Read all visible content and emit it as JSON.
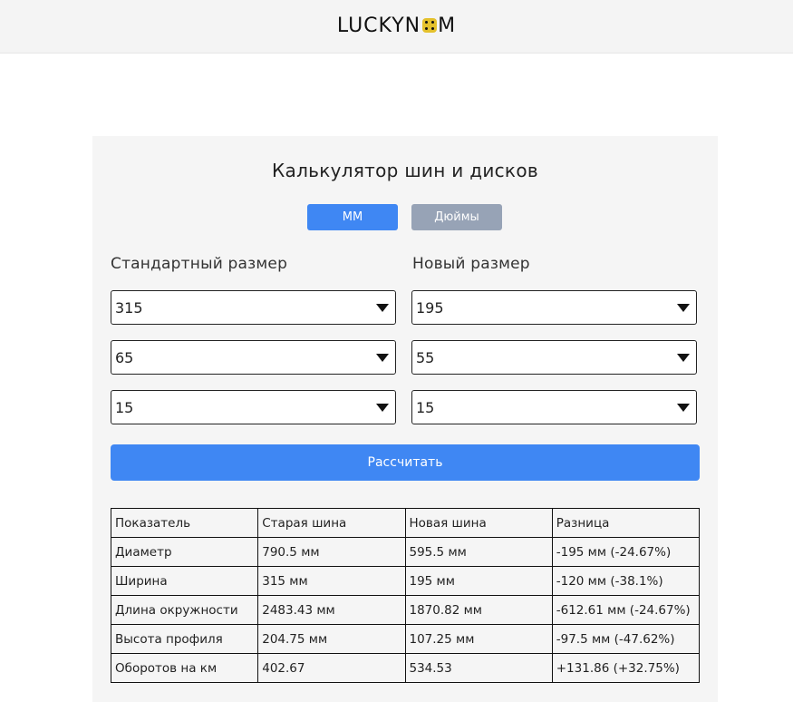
{
  "header": {
    "logo_left": "LUCKYN",
    "logo_right": "M"
  },
  "calculator": {
    "title": "Калькулятор шин и дисков",
    "unit_mm": "ММ",
    "unit_inches": "Дюймы",
    "standard_label": "Стандартный размер",
    "new_label": "Новый размер",
    "standard": {
      "width": "315",
      "profile": "65",
      "rim": "15"
    },
    "new": {
      "width": "195",
      "profile": "55",
      "rim": "15"
    },
    "calculate_label": "Рассчитать"
  },
  "table": {
    "headers": [
      "Показатель",
      "Старая шина",
      "Новая шина",
      "Разница"
    ],
    "rows": [
      [
        "Диаметр",
        "790.5 мм",
        "595.5 мм",
        "-195 мм (-24.67%)"
      ],
      [
        "Ширина",
        "315 мм",
        "195 мм",
        "-120 мм (-38.1%)"
      ],
      [
        "Длина окружности",
        "2483.43 мм",
        "1870.82 мм",
        "-612.61 мм (-24.67%)"
      ],
      [
        "Высота профиля",
        "204.75 мм",
        "107.25 мм",
        "-97.5 мм (-47.62%)"
      ],
      [
        "Оборотов на км",
        "402.67",
        "534.53",
        "+131.86 (+32.75%)"
      ]
    ]
  },
  "colors": {
    "accent": "#3f87f3",
    "inactive": "#97a3b6",
    "logo_dice": "#e4c12c"
  }
}
